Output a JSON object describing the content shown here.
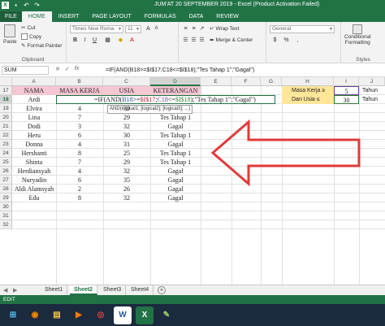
{
  "window": {
    "title": "JUM'AT 20 SEPTEMBER 2019 -  Excel (Product Activation Failed)"
  },
  "ribbon_tabs": [
    "FILE",
    "HOME",
    "INSERT",
    "PAGE LAYOUT",
    "FORMULAS",
    "DATA",
    "REVIEW"
  ],
  "ribbon": {
    "paste": "Paste",
    "cut": "Cut",
    "copy": "Copy",
    "format_painter": "Format Painter",
    "clipboard": "Clipboard",
    "font_name": "Times New Roma",
    "font_size": "11",
    "wrap_text": "Wrap Text",
    "merge_center": "Merge & Center",
    "number_format": "General",
    "conditional": "Conditional",
    "formatting": "Formatting",
    "styles": "Styles"
  },
  "formula_bar": {
    "name_box": "SUM",
    "icons": [
      "✕",
      "✓",
      "fx"
    ],
    "formula": "=IF(AND(B18>=$I$17;C18<=$I$18);\"Tes Tahap 1\";\"Gagal\")"
  },
  "grid": {
    "columns": [
      "A",
      "B",
      "C",
      "D",
      "E",
      "F",
      "G",
      "H",
      "I",
      "J"
    ],
    "rows": [
      "17",
      "18",
      "19",
      "20",
      "21",
      "22",
      "23",
      "24",
      "25",
      "26",
      "27",
      "28",
      "29",
      "30",
      "31",
      "32"
    ],
    "headers": {
      "nama": "NAMA",
      "masa_kerja": "MASA KERJA",
      "usia": "USIA",
      "keterangan": "KETERANGAN"
    },
    "criteria": {
      "masa_label": "Masa Kerja ≥",
      "masa_value": "5",
      "masa_unit": "Tahun",
      "usia_label": "Dan Usia ≤",
      "usia_value": "30",
      "usia_unit": "Tahun"
    },
    "editing": {
      "prefix": "=IF(AND(",
      "ref1": "B18",
      "op1": ">=",
      "ref2": "$I$17",
      "sep": ";",
      "ref3": "C18",
      "op2": "<=",
      "ref4": "$I$18",
      "suffix": ");\"Tes Tahap 1\";\"Gagal\")",
      "tooltip": "AND(logical1; [logical2]; [logical3]; ...)",
      "name": "Ardi"
    },
    "data": [
      {
        "nama": "Elvira",
        "masa": "4",
        "usia": "30",
        "ket": ""
      },
      {
        "nama": "Lina",
        "masa": "7",
        "usia": "29",
        "ket": "Tes Tahap 1"
      },
      {
        "nama": "Dodi",
        "masa": "3",
        "usia": "32",
        "ket": "Gagal"
      },
      {
        "nama": "Heru",
        "masa": "6",
        "usia": "30",
        "ket": "Tes Tahap 1"
      },
      {
        "nama": "Donna",
        "masa": "4",
        "usia": "31",
        "ket": "Gagal"
      },
      {
        "nama": "Hershanti",
        "masa": "8",
        "usia": "25",
        "ket": "Tes Tahap 1"
      },
      {
        "nama": "Shinta",
        "masa": "7",
        "usia": "29",
        "ket": "Tes Tahap 1"
      },
      {
        "nama": "Herdiansyah",
        "masa": "4",
        "usia": "32",
        "ket": "Gagal"
      },
      {
        "nama": "Nuryadin",
        "masa": "6",
        "usia": "35",
        "ket": "Gagal"
      },
      {
        "nama": "Aldi Alamsyah",
        "masa": "2",
        "usia": "26",
        "ket": "Gagal"
      },
      {
        "nama": "Edu",
        "masa": "8",
        "usia": "32",
        "ket": "Gagal"
      }
    ]
  },
  "sheets": [
    "Sheet1",
    "Sheet2",
    "Sheet3",
    "Sheet4"
  ],
  "active_sheet": "Sheet2",
  "status": "EDIT",
  "arrow_color": "#e03a3a",
  "taskbar": [
    "windows-start-icon",
    "firefox-icon",
    "file-explorer-icon",
    "media-player-icon",
    "chrome-icon",
    "word-icon",
    "excel-icon",
    "paint-icon"
  ]
}
